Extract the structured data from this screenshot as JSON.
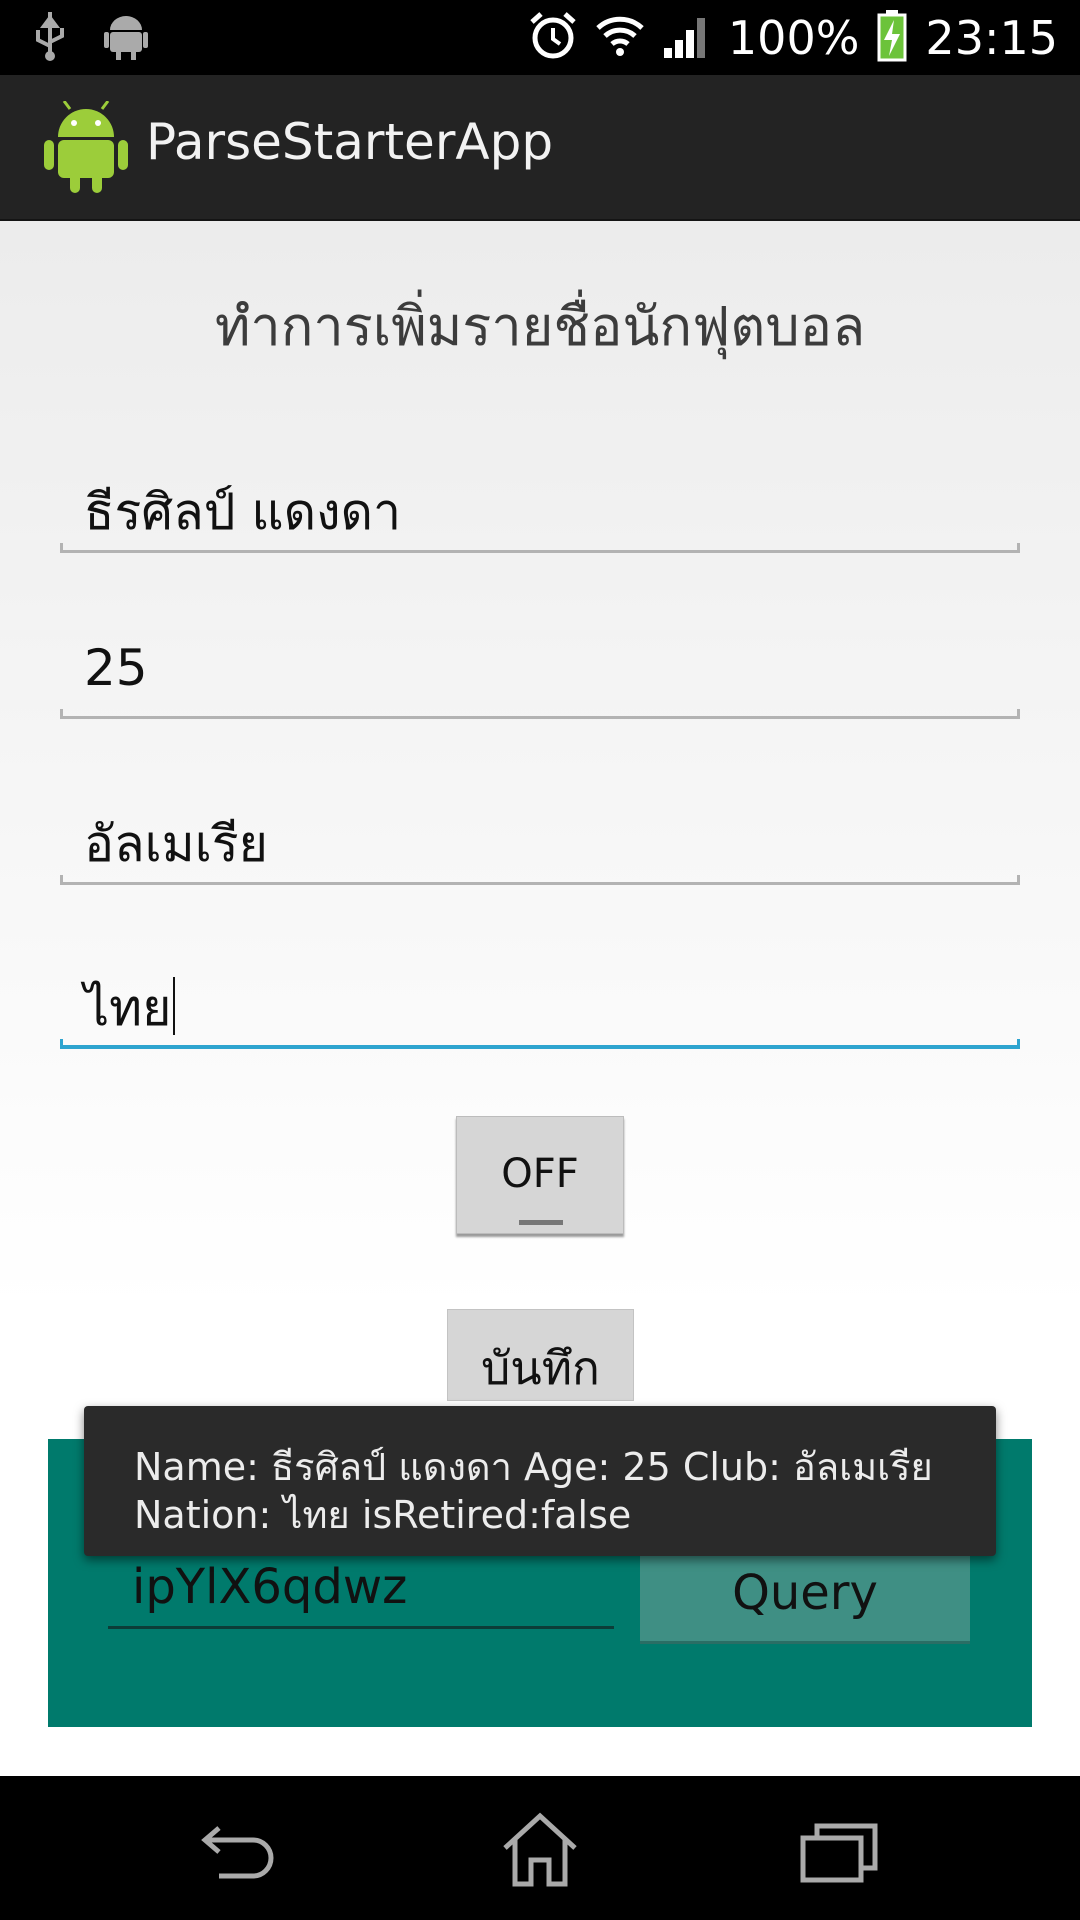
{
  "status_bar": {
    "battery_percent": "100%",
    "time": "23:15",
    "icons": [
      "usb-icon",
      "android-debug-icon",
      "alarm-icon",
      "wifi-icon",
      "signal-icon",
      "battery-charging-icon"
    ]
  },
  "action_bar": {
    "title": "ParseStarterApp",
    "icon": "android-app-icon"
  },
  "form": {
    "heading": "ทำการเพิ่มรายชื่อนักฟุตบอล",
    "name_value": "ธีรศิลป์ แดงดา",
    "age_value": "25",
    "club_value": "อัลเมเรีย",
    "nation_value": "ไทย",
    "retired_toggle_label": "OFF",
    "save_label": "บันทึก"
  },
  "query_panel": {
    "object_id_value": "ipYlX6qdwz",
    "query_label": "Query",
    "bg_color": "#007a6c"
  },
  "toast": {
    "line1": "Name: ธีรศิลป์ แดงดา Age: 25 Club: อัลเมเรีย",
    "line2": "Nation: ไทย isRetired:false"
  },
  "nav_bar": {
    "icons": [
      "back-icon",
      "home-icon",
      "recent-apps-icon"
    ]
  }
}
